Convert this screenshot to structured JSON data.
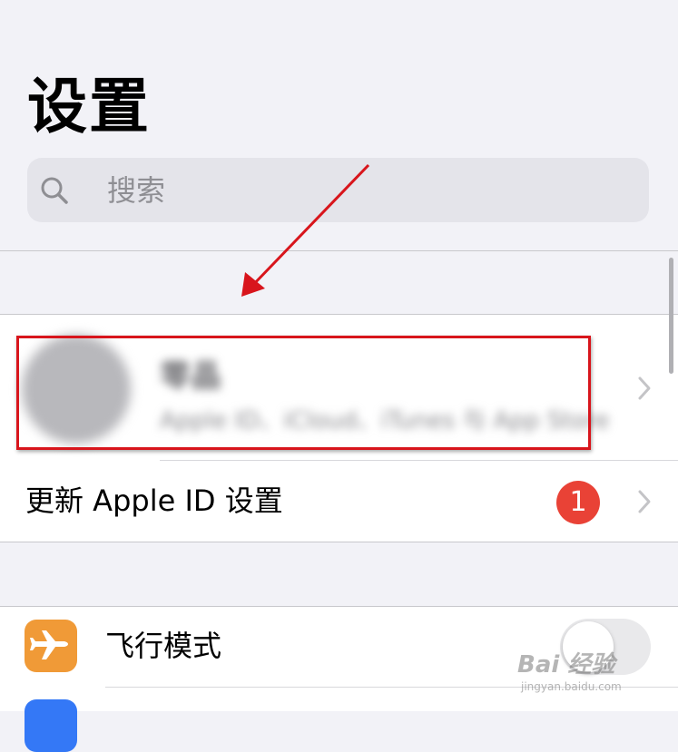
{
  "header": {
    "title": "设置"
  },
  "search": {
    "icon": "search-icon",
    "placeholder": "搜索"
  },
  "profile": {
    "name": "零晶",
    "subtitle": "Apple ID、iCloud、iTunes 与 App Store",
    "note": "blurred avatar and text"
  },
  "rows": {
    "update_apple_id": {
      "label": "更新 Apple ID 设置",
      "badge": "1"
    },
    "airplane_mode": {
      "label": "飞行模式",
      "icon": "airplane-icon",
      "icon_color": "#f09a37",
      "toggle_on": false
    }
  },
  "colors": {
    "badge": "#e94236",
    "annotation_red": "#d8151c",
    "wifi_icon": "#3478f6"
  },
  "watermark": {
    "text": "Bai 经验",
    "sub": "jingyan.baidu.com"
  }
}
